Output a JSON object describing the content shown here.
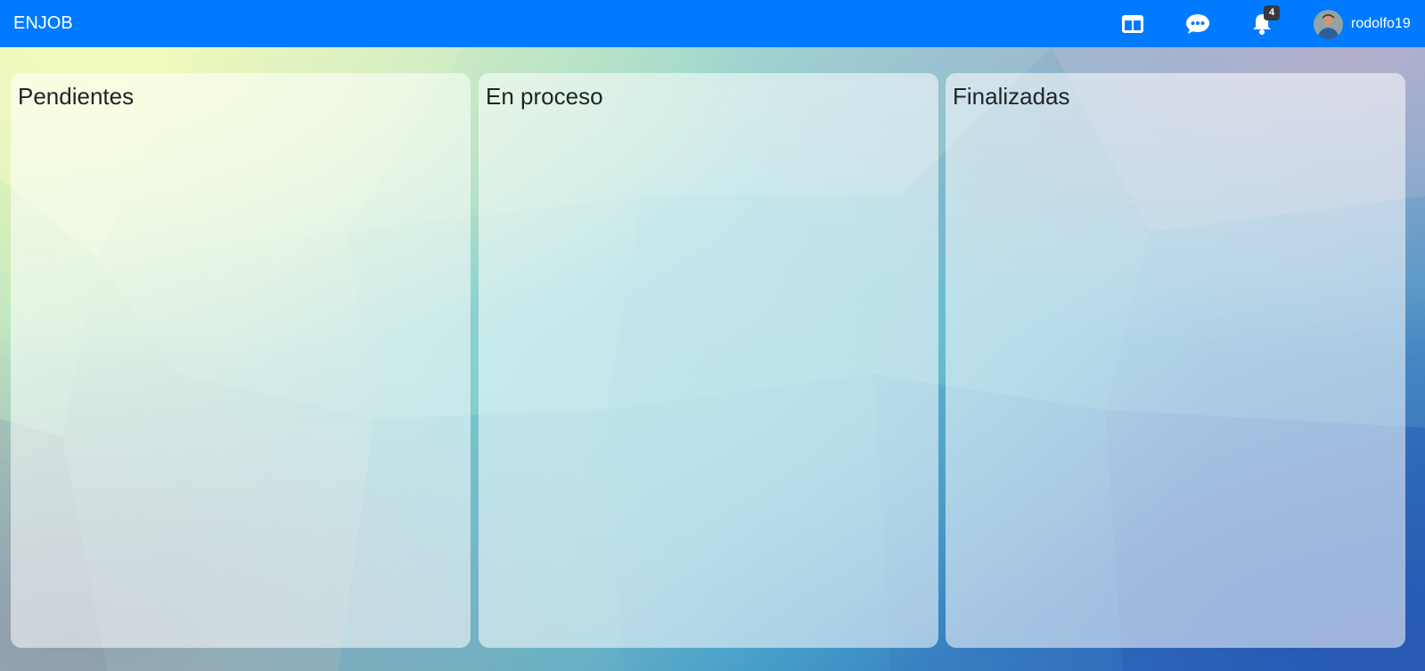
{
  "app": {
    "brand": "ENJOB"
  },
  "navbar": {
    "background_color": "#007bff",
    "icons": {
      "board": "columns-icon",
      "chat": "chat-icon",
      "notifications": "bell-icon"
    },
    "notification_count": "4",
    "user": {
      "username": "rodolfo19",
      "avatar": "avatar"
    }
  },
  "board": {
    "columns": [
      {
        "title": "Pendientes"
      },
      {
        "title": "En proceso"
      },
      {
        "title": "Finalizadas"
      }
    ]
  }
}
